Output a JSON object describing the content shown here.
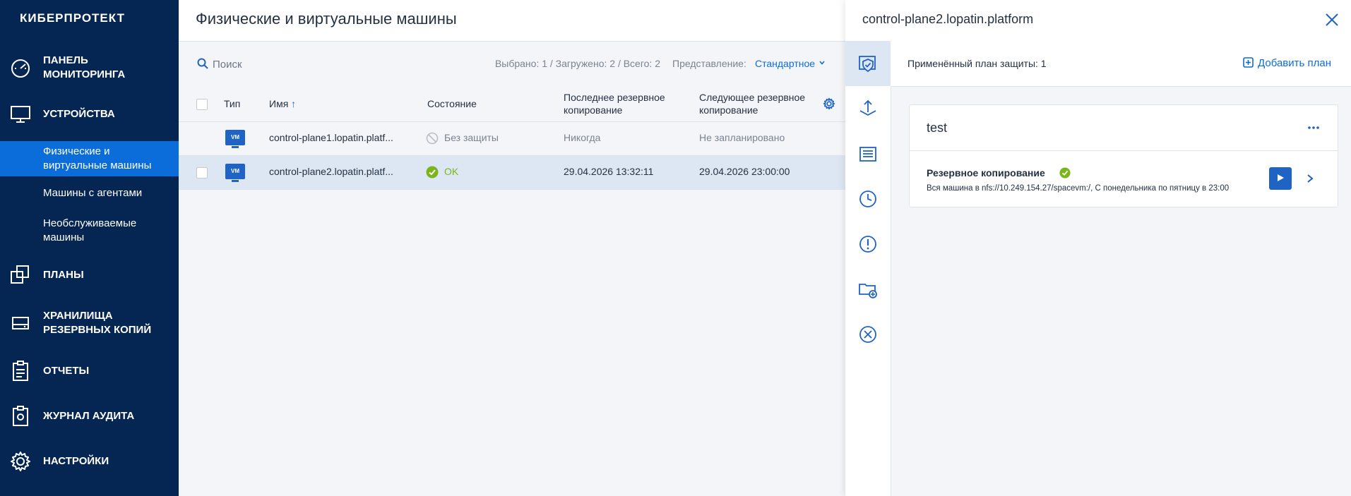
{
  "sidebar": {
    "logo": "КИБЕРПРОТЕКТ",
    "items": [
      {
        "label": "ПАНЕЛЬ\nМОНИТОРИНГА"
      },
      {
        "label": "УСТРОЙСТВА"
      },
      {
        "label": "ПЛАНЫ"
      },
      {
        "label": "ХРАНИЛИЩА\nРЕЗЕРВНЫХ КОПИЙ"
      },
      {
        "label": "ОТЧЕТЫ"
      },
      {
        "label": "ЖУРНАЛ АУДИТА"
      },
      {
        "label": "НАСТРОЙКИ"
      }
    ],
    "subitems": [
      {
        "label": "Физические и\nвиртуальные машины"
      },
      {
        "label": "Машины с агентами"
      },
      {
        "label": "Необслуживаемые\nмашины"
      }
    ]
  },
  "main": {
    "title": "Физические и виртуальные машины",
    "search_placeholder": "Поиск",
    "counts": "Выбрано: 1 / Загружено: 2 / Всего: 2",
    "view_label": "Представление:",
    "view_value": "Стандартное",
    "columns": {
      "type": "Тип",
      "name": "Имя",
      "status": "Состояние",
      "last_backup": "Последнее резервное\nкопирование",
      "next_backup": "Следующее резервное\nкопирование"
    },
    "rows": [
      {
        "badge": "VM",
        "name": "control-plane1.lopatin.platf...",
        "status": "Без защиты",
        "last": "Никогда",
        "next": "Не запланировано"
      },
      {
        "badge": "VM",
        "name": "control-plane2.lopatin.platf...",
        "status": "OK",
        "last": "29.04.2026 13:32:11",
        "next": "29.04.2026 23:00:00"
      }
    ]
  },
  "panel": {
    "title": "control-plane2.lopatin.platform",
    "applied": "Применённый план защиты: 1",
    "add_plan": "Добавить план",
    "plan": {
      "name": "test",
      "task_title": "Резервное копирование",
      "task_desc": "Вся машина в nfs://10.249.154.27/spacevm:/, С понедельника по пятницу в 23:00"
    }
  },
  "colors": {
    "sidebar_bg": "#052552",
    "accent": "#0b6dd9",
    "ok": "#7bb51b"
  }
}
